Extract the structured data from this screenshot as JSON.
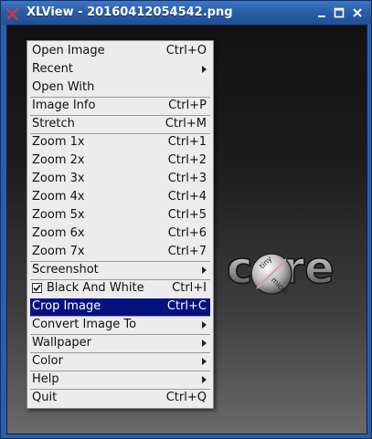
{
  "window": {
    "title": "XLView - 20160412054542.png",
    "icon": "xlview-app-icon",
    "buttons": [
      "minimize-icon",
      "maximize-icon",
      "close-icon"
    ]
  },
  "menu": {
    "items": [
      {
        "label": "Open Image",
        "accel": "Ctrl+O"
      },
      {
        "label": "Recent",
        "submenu": true
      },
      {
        "label": "Open With"
      },
      {
        "label": "Image Info",
        "accel": "Ctrl+P"
      },
      {
        "label": "Stretch",
        "accel": "Ctrl+M"
      },
      {
        "label": "Zoom 1x",
        "accel": "Ctrl+1"
      },
      {
        "label": "Zoom 2x",
        "accel": "Ctrl+2"
      },
      {
        "label": "Zoom 3x",
        "accel": "Ctrl+3"
      },
      {
        "label": "Zoom 4x",
        "accel": "Ctrl+4"
      },
      {
        "label": "Zoom 5x",
        "accel": "Ctrl+5"
      },
      {
        "label": "Zoom 6x",
        "accel": "Ctrl+6"
      },
      {
        "label": "Zoom 7x",
        "accel": "Ctrl+7"
      },
      {
        "label": "Screenshot",
        "submenu": true
      },
      {
        "label": "Black And White",
        "accel": "Ctrl+I",
        "checked": true
      },
      {
        "label": "Crop Image",
        "accel": "Ctrl+C",
        "selected": true
      },
      {
        "label": "Convert Image To",
        "submenu": true
      },
      {
        "label": "Wallpaper",
        "submenu": true
      },
      {
        "label": "Color",
        "submenu": true
      },
      {
        "label": "Help",
        "submenu": true
      },
      {
        "label": "Quit",
        "accel": "Ctrl+Q"
      }
    ]
  },
  "image": {
    "logo_text": "core",
    "logo_small_1": "tiny",
    "logo_small_2": "micro"
  },
  "colors": {
    "titlebar": "#2a5da7",
    "selection": "#05117e",
    "menu_bg": "#ececec"
  }
}
